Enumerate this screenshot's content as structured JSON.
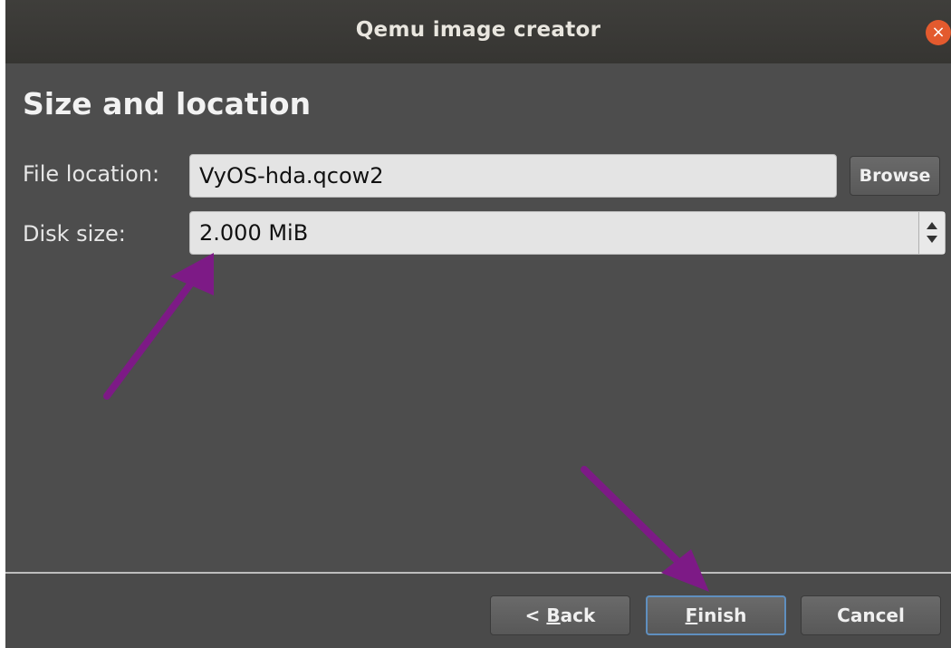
{
  "window": {
    "title": "Qemu image creator",
    "close_glyph": "×"
  },
  "page": {
    "heading": "Size and location"
  },
  "form": {
    "file_location_label": "File location:",
    "file_location_value": "VyOS-hda.qcow2",
    "browse_label": "Browse",
    "disk_size_label": "Disk size:",
    "disk_size_value": "2.000 MiB"
  },
  "footer": {
    "back_prefix": "< ",
    "back_mnemonic": "B",
    "back_rest": "ack",
    "finish_mnemonic": "F",
    "finish_rest": "inish",
    "cancel_label": "Cancel"
  },
  "colors": {
    "annotation_arrow": "#7d1a86",
    "default_button_border": "#5f8fbf",
    "close_button": "#e35a2e"
  }
}
